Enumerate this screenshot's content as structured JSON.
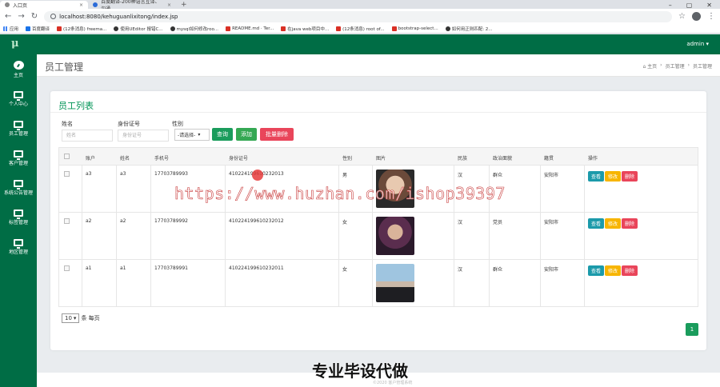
{
  "browser": {
    "tabs": [
      {
        "title": "入口页",
        "close": "×"
      },
      {
        "title": "百度翻译-200种语言互译、沟通",
        "close": "×"
      }
    ],
    "new_tab": "+",
    "window_controls": [
      "–",
      "▢",
      "✕"
    ],
    "url": "localhost:8080/kehuguanlixitong/index.jsp",
    "bookmarks": [
      "应用",
      "百度翻译",
      "(12条消息) freema...",
      "使用UEditor 报错C...",
      "mysql如何修改roo...",
      "README.md · Ter...",
      "在java web项目中...",
      "(12条消息) root of...",
      "bootstrap-select...",
      "如何用正则匹配: 2..."
    ]
  },
  "app": {
    "brand": "μ",
    "admin_label": "admin ▾"
  },
  "sidebar": {
    "items": [
      {
        "label": "主页",
        "icon": "dashboard-icon"
      },
      {
        "label": "个人中心",
        "icon": "monitor-icon"
      },
      {
        "label": "员工管理",
        "icon": "monitor-icon"
      },
      {
        "label": "客户管理",
        "icon": "monitor-icon"
      },
      {
        "label": "系统公告管理",
        "icon": "monitor-icon"
      },
      {
        "label": "标签管理",
        "icon": "monitor-icon"
      },
      {
        "label": "地区管理",
        "icon": "monitor-icon"
      }
    ]
  },
  "header": {
    "title": "员工管理",
    "breadcrumb": [
      "⌂ 主页",
      "›",
      "员工管理",
      "›",
      "员工管理"
    ]
  },
  "card": {
    "title": "员工列表"
  },
  "filters": {
    "name_label": "姓名",
    "name_placeholder": "姓名",
    "id_label": "身份证号",
    "id_placeholder": "身份证号",
    "gender_label": "性别",
    "gender_value": "-请选择-",
    "search": "查询",
    "add": "添加",
    "bulk_delete": "批量删除"
  },
  "table": {
    "headers": [
      "账户",
      "姓名",
      "手机号",
      "身份证号",
      "性别",
      "图片",
      "民族",
      "政治面貌",
      "籍贯",
      "操作"
    ],
    "rows": [
      {
        "account": "a3",
        "name": "a3",
        "phone": "17703789993",
        "idcard": "410224199610232013",
        "gender": "男",
        "nation": "汉",
        "politics": "群众",
        "native": "安阳市"
      },
      {
        "account": "a2",
        "name": "a2",
        "phone": "17703789992",
        "idcard": "410224199610232012",
        "gender": "女",
        "nation": "汉",
        "politics": "党员",
        "native": "安阳市"
      },
      {
        "account": "a1",
        "name": "a1",
        "phone": "17703789991",
        "idcard": "410224199610232011",
        "gender": "女",
        "nation": "汉",
        "politics": "群众",
        "native": "安阳市"
      }
    ],
    "actions": {
      "view": "查看",
      "edit": "修改",
      "delete": "删除"
    }
  },
  "pager": {
    "page_size": "10",
    "suffix": "条 每页",
    "current_page": "1"
  },
  "overlay": {
    "watermark": "https://www.huzhan.com/ishop39397",
    "promo": "专业毕设代做",
    "footer": "©2020 客户管理系统"
  }
}
